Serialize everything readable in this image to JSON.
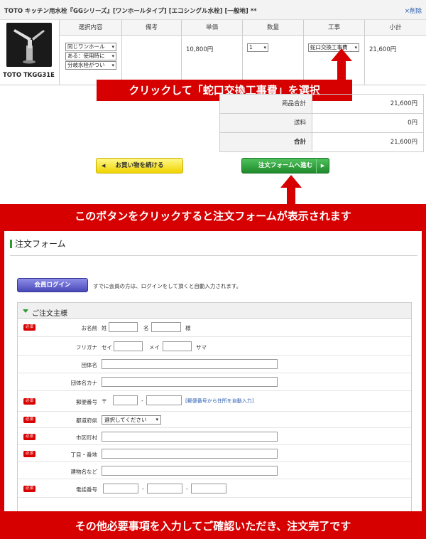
{
  "cart": {
    "title": "TOTO キッチン用水栓『GGシリーズ』[ワンホールタイプ] [エコシングル水栓] [一般地] **",
    "delete_label": "×削除",
    "headers": [
      "選択内容",
      "備考",
      "単価",
      "数量",
      "工事",
      "小計"
    ],
    "product_name": "TOTO TKGG31E",
    "options": [
      "同じワンホール",
      "ある：使用時に",
      "分岐水栓がつい"
    ],
    "unit_price": "10,800円",
    "quantity": "1",
    "construction": "蛇口交換工事費",
    "subtotal": "21,600円"
  },
  "annotations": {
    "select_construction": "クリックして「蛇口交換工事費」を選択",
    "form_shown": "このボタンをクリックすると注文フォームが表示されます",
    "complete": "その他必要事項を入力してご確認いただき、注文完了です"
  },
  "summary": {
    "rows": [
      {
        "label": "商品合計",
        "value": "21,600円"
      },
      {
        "label": "送料",
        "value": "0円"
      },
      {
        "label": "合計",
        "value": "21,600円"
      }
    ]
  },
  "buttons": {
    "continue": "お買い物を続ける",
    "proceed": "注文フォームへ進む"
  },
  "form": {
    "title": "注文フォーム",
    "login_button": "会員ログイン",
    "login_note": "すでに会員の方は、ログインをして頂くと自動入力されます。",
    "section_title": "ご注文主様",
    "required_badge": "必須",
    "name_label": "お名前",
    "name_sei": "姓",
    "name_mei": "名",
    "name_suffix": "様",
    "kana_label": "フリガナ",
    "kana_sei": "セイ",
    "kana_mei": "メイ",
    "kana_suffix": "サマ",
    "company_label": "団体名",
    "company_kana_label": "団体名カナ",
    "zip_label": "郵便番号",
    "zip_mark": "〒",
    "zip_link": "[郵便番号から住所を自動入力]",
    "pref_label": "都道府県",
    "pref_select": "選択してください",
    "city_label": "市区町村",
    "street_label": "丁目・番地",
    "building_label": "建物名など",
    "phone_label": "電話番号",
    "dash": "-"
  },
  "colors": {
    "accent_red": "#d60000",
    "accent_green": "#2c9a2c",
    "link_blue": "#2a5db0"
  }
}
